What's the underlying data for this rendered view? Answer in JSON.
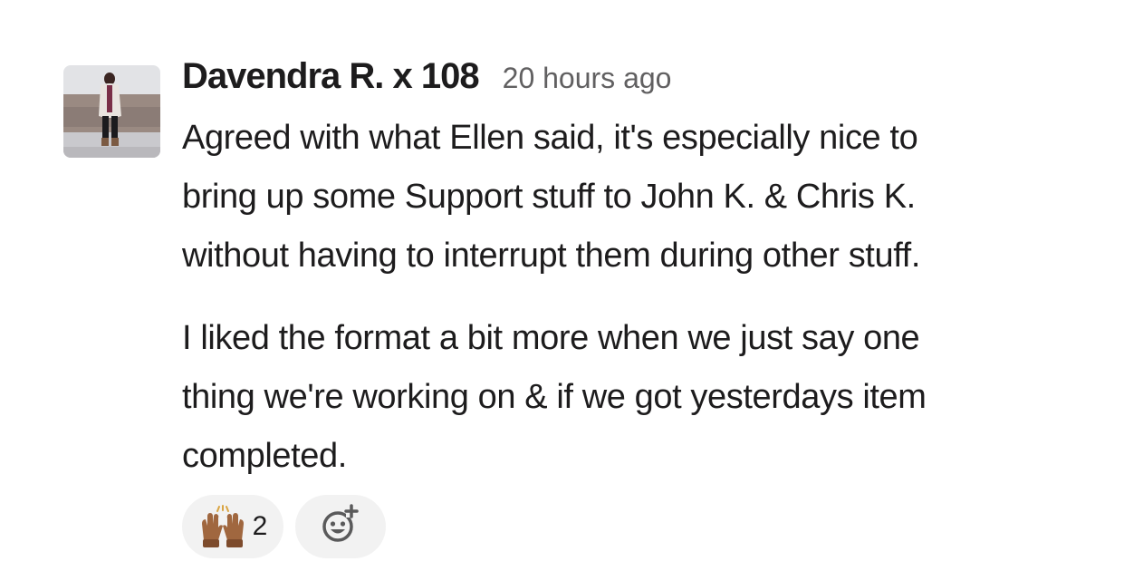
{
  "message": {
    "sender": "Davendra R. x 108",
    "timestamp": "20 hours ago",
    "paragraphs": [
      {
        "lines": [
          "Agreed with what Ellen said, it's especially nice to",
          "bring up some Support stuff to John K. & Chris K.",
          "without having to interrupt them during other stuff."
        ]
      },
      {
        "lines": [
          "I liked the format a bit more when we just say one",
          "thing we're working on & if we got yesterdays item",
          "completed."
        ]
      }
    ]
  },
  "reactions": [
    {
      "emoji": "raising-hands-icon",
      "count": "2"
    }
  ],
  "add_reaction": {
    "icon": "add-emoji-icon"
  },
  "colors": {
    "text": "#1d1c1d",
    "muted": "#616061",
    "pill": "#f2f2f2"
  }
}
